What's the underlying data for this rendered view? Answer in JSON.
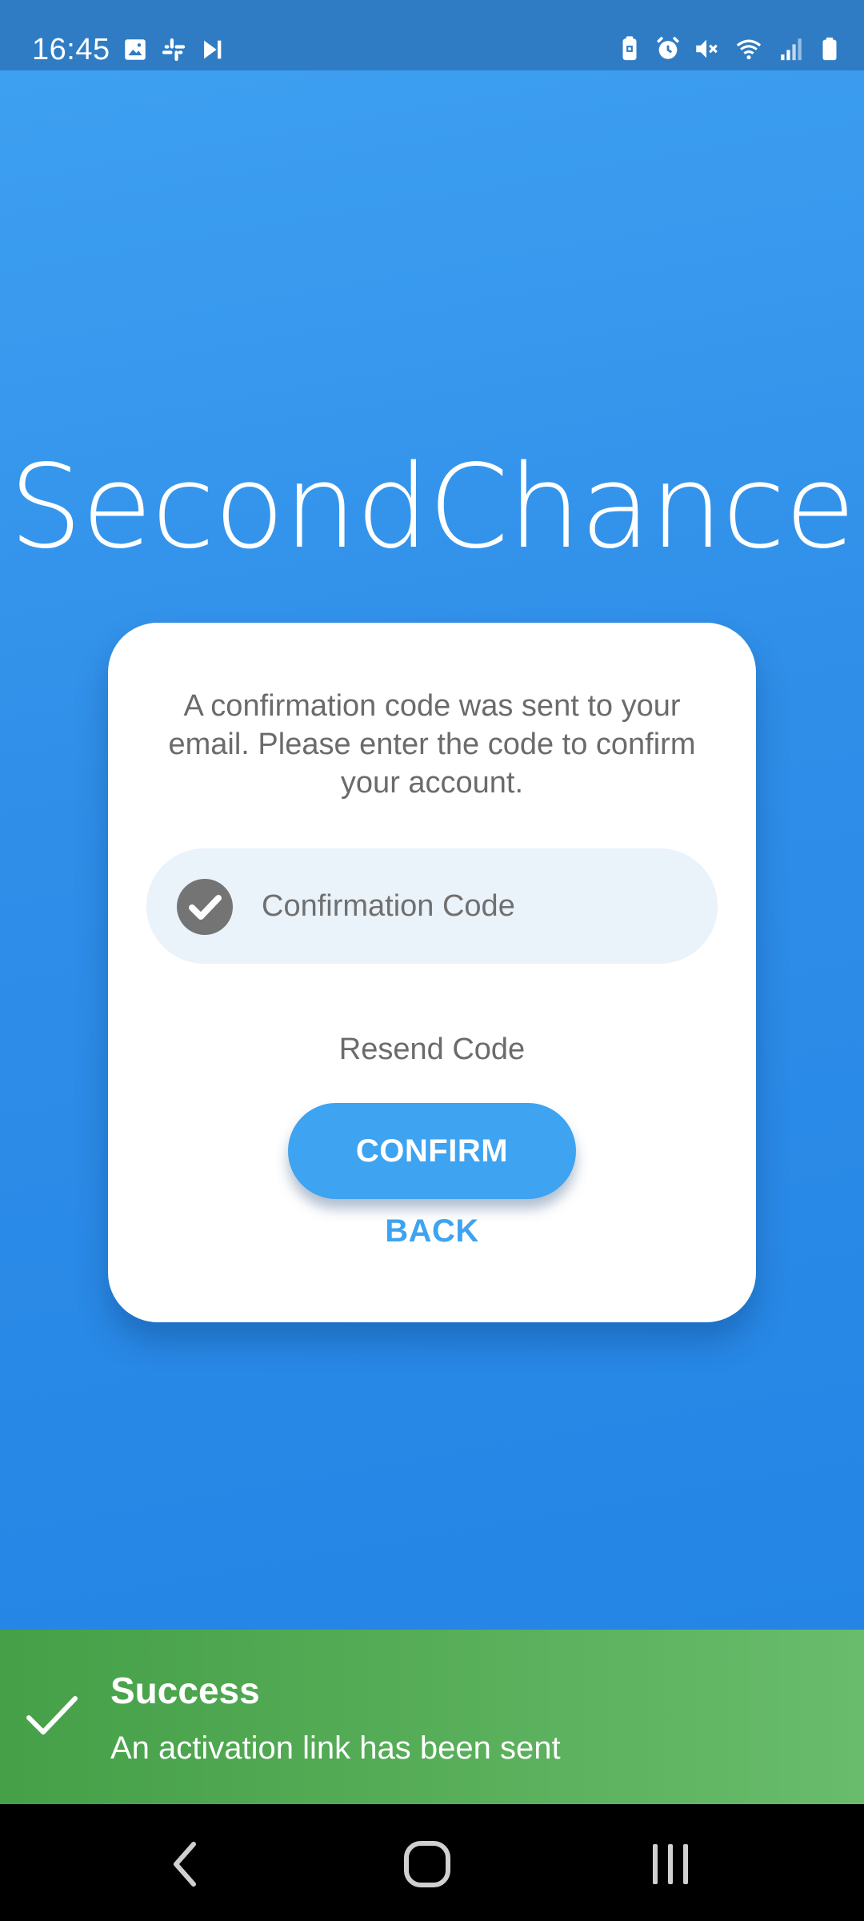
{
  "status_bar": {
    "time": "16:45",
    "left_icons": [
      "image-icon",
      "slack-icon",
      "skip-next-icon"
    ],
    "right_icons": [
      "battery-saver-icon",
      "alarm-icon",
      "mute-icon",
      "wifi-icon",
      "signal-icon",
      "battery-icon"
    ]
  },
  "app": {
    "title": "SecondChance"
  },
  "card": {
    "message": "A confirmation code was sent to your email. Please enter the code to confirm your account.",
    "code_field": {
      "icon": "check-circle-icon",
      "placeholder": "Confirmation Code",
      "value": ""
    },
    "resend_label": "Resend Code",
    "confirm_label": "CONFIRM",
    "back_label": "BACK"
  },
  "snackbar": {
    "icon": "check-icon",
    "title": "Success",
    "message": "An activation link has been sent"
  },
  "nav_bar": {
    "buttons": [
      "back-icon",
      "home-icon",
      "recents-icon"
    ]
  },
  "colors": {
    "primary": "#3ea3f1",
    "background_top": "#3ea0f1",
    "background_bottom": "#2485e5",
    "success": "#55ac56",
    "card": "#ffffff",
    "input_bg": "#eaf2fa"
  }
}
